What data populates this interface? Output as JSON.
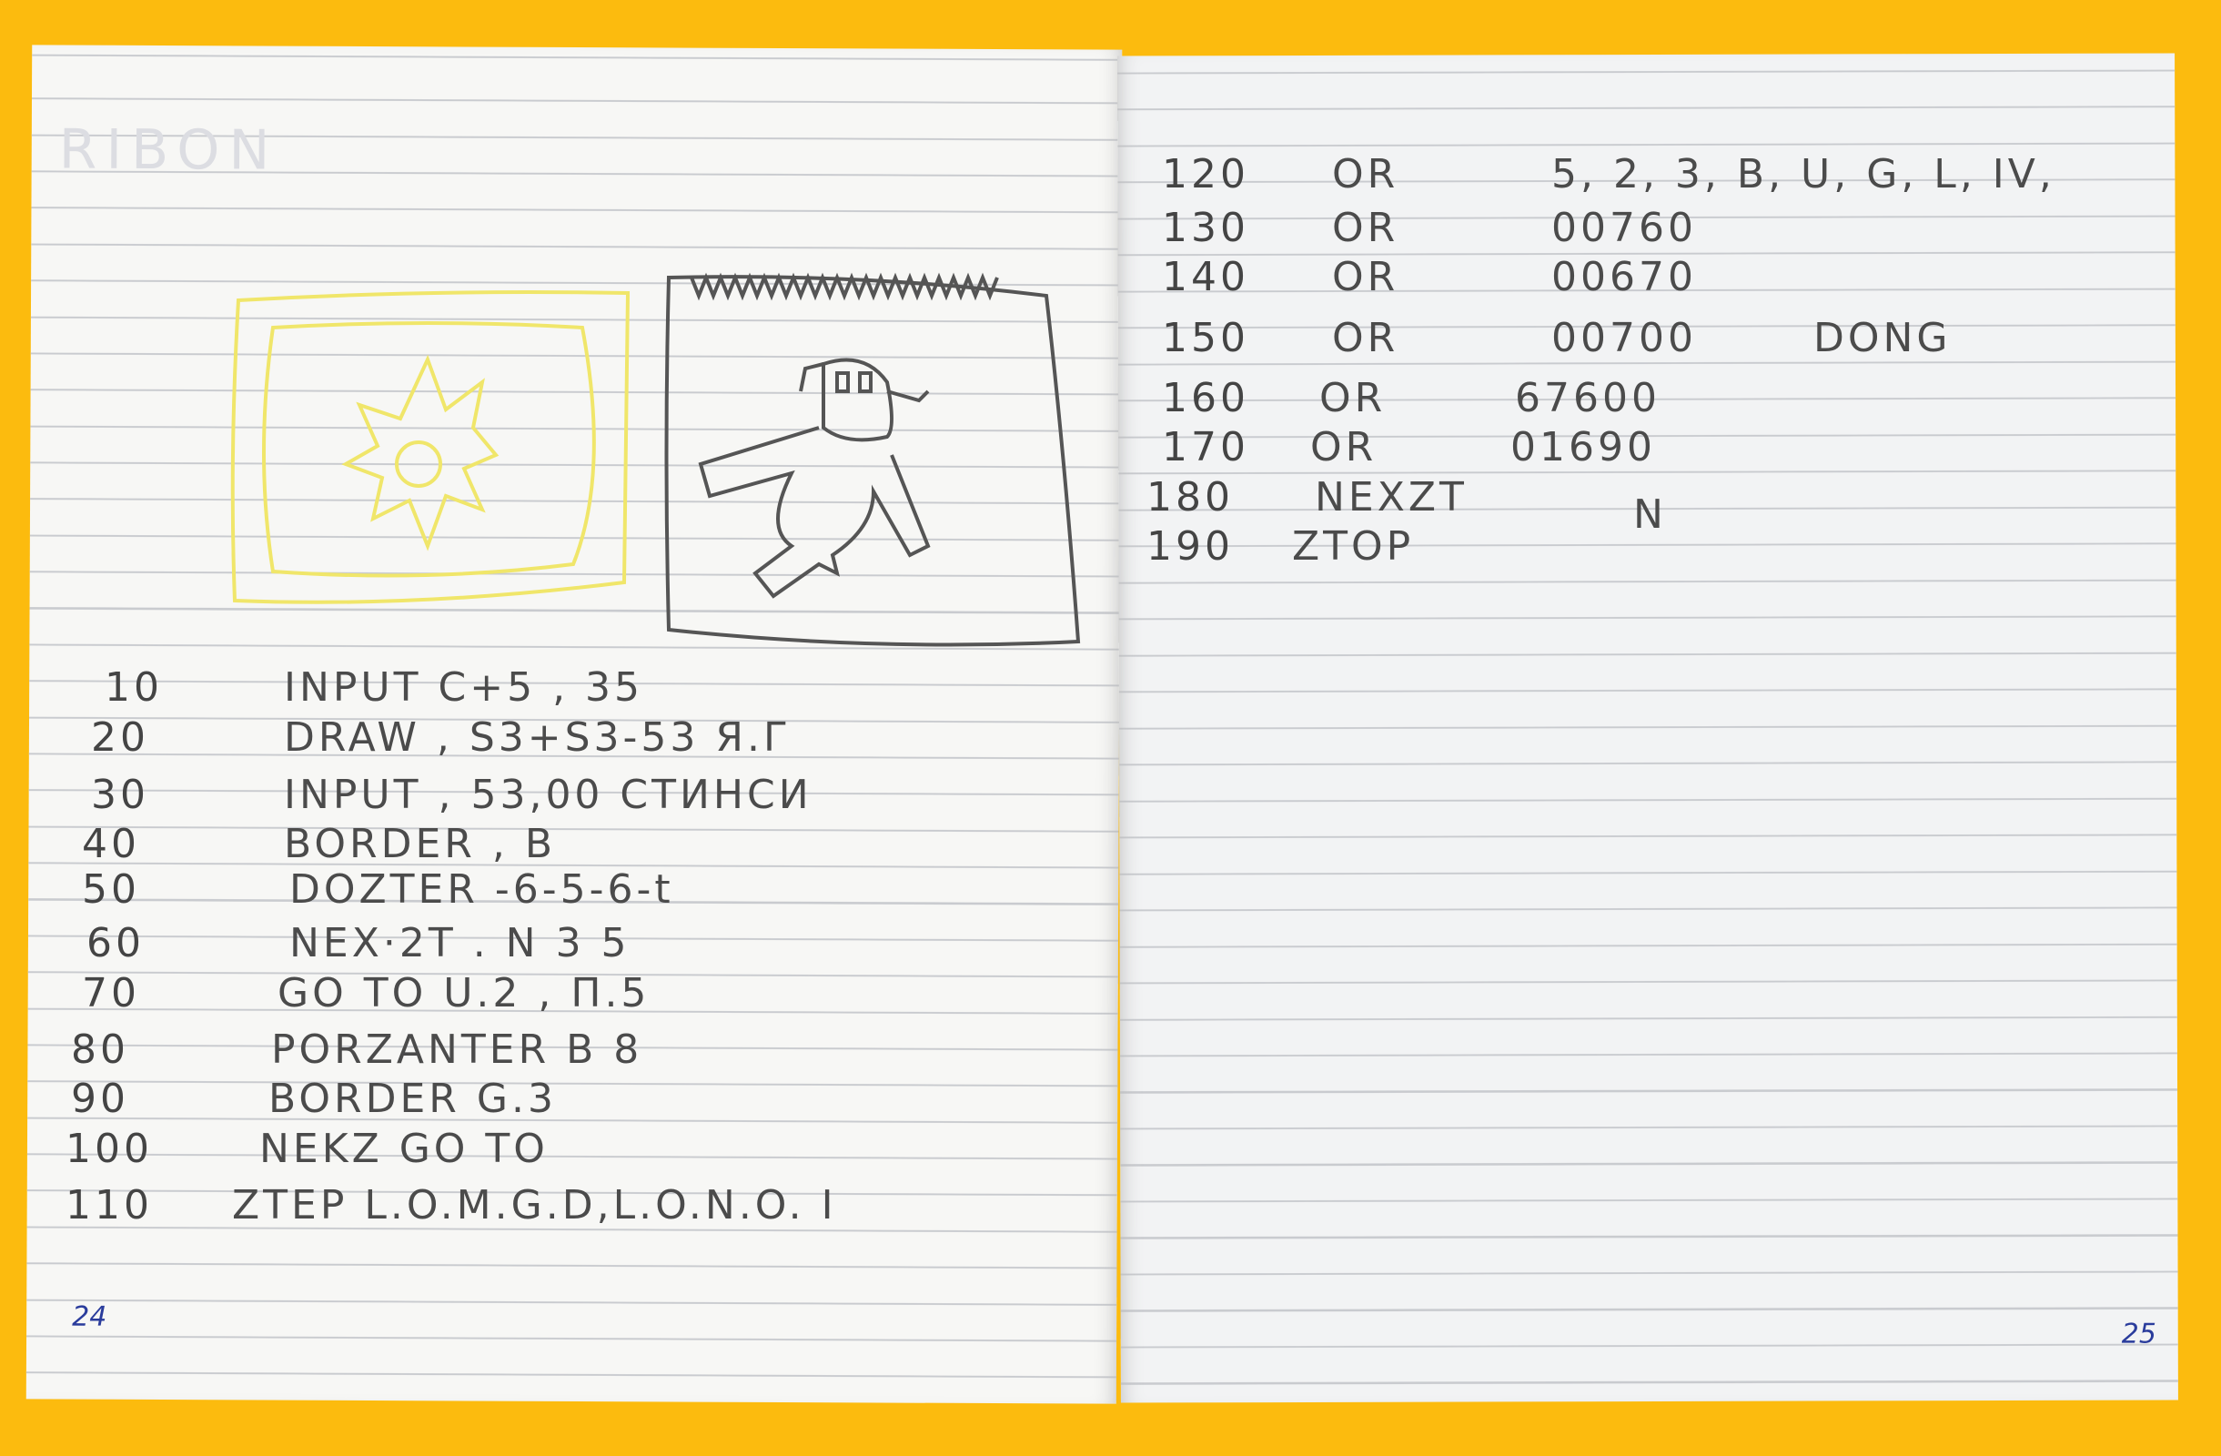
{
  "background_color": "#fcbb0e",
  "left_page": {
    "faint_heading": "RIBON",
    "page_number": "24",
    "code_lines": [
      {
        "line": "10",
        "text": "INPUT C+5 , 35"
      },
      {
        "line": "20",
        "text": "DRAW , S3+S3-53 Я.Г"
      },
      {
        "line": "30",
        "text": "INPUT , 53,00 СТИНСИ"
      },
      {
        "line": "40",
        "text": "BORDER , B"
      },
      {
        "line": "50",
        "text": "DOZTER -6-5-6-t"
      },
      {
        "line": "60",
        "text": "NEX·2T . N 3   5"
      },
      {
        "line": "70",
        "text": "GO TO  U.2 , П.5"
      },
      {
        "line": "80",
        "text": "PORZANTER  B 8"
      },
      {
        "line": "90",
        "text": "BORDER  G.3"
      },
      {
        "line": "100",
        "text": "NEKZ  GO  TO"
      },
      {
        "line": "110",
        "text": "ZTEP  L.O.M.G.D,L.O.N.O. I"
      }
    ]
  },
  "right_page": {
    "page_number": "25",
    "code_lines": [
      {
        "line": "120",
        "op": "OR",
        "value": "5, 2, 3, B, U, G, L, IV,",
        "note": ""
      },
      {
        "line": "130",
        "op": "OR",
        "value": "00760",
        "note": ""
      },
      {
        "line": "140",
        "op": "OR",
        "value": "00670",
        "note": ""
      },
      {
        "line": "150",
        "op": "OR",
        "value": "00700",
        "note": "DONG"
      },
      {
        "line": "160",
        "op": "OR",
        "value": "67600",
        "note": ""
      },
      {
        "line": "170",
        "op": "OR",
        "value": "01690",
        "note": ""
      },
      {
        "line": "180",
        "op": "NEXZT",
        "value": "N",
        "note": ""
      },
      {
        "line": "190",
        "op": "ZTOP",
        "value": "",
        "note": ""
      }
    ]
  },
  "drawings": {
    "left": "yellow-explosion-sketch",
    "right": "robot-figure-sketch"
  },
  "colors": {
    "pencil": "#4b4b4b",
    "yellow_pencil": "#f3ea6a",
    "page_number_ink": "#2a3c9c"
  }
}
